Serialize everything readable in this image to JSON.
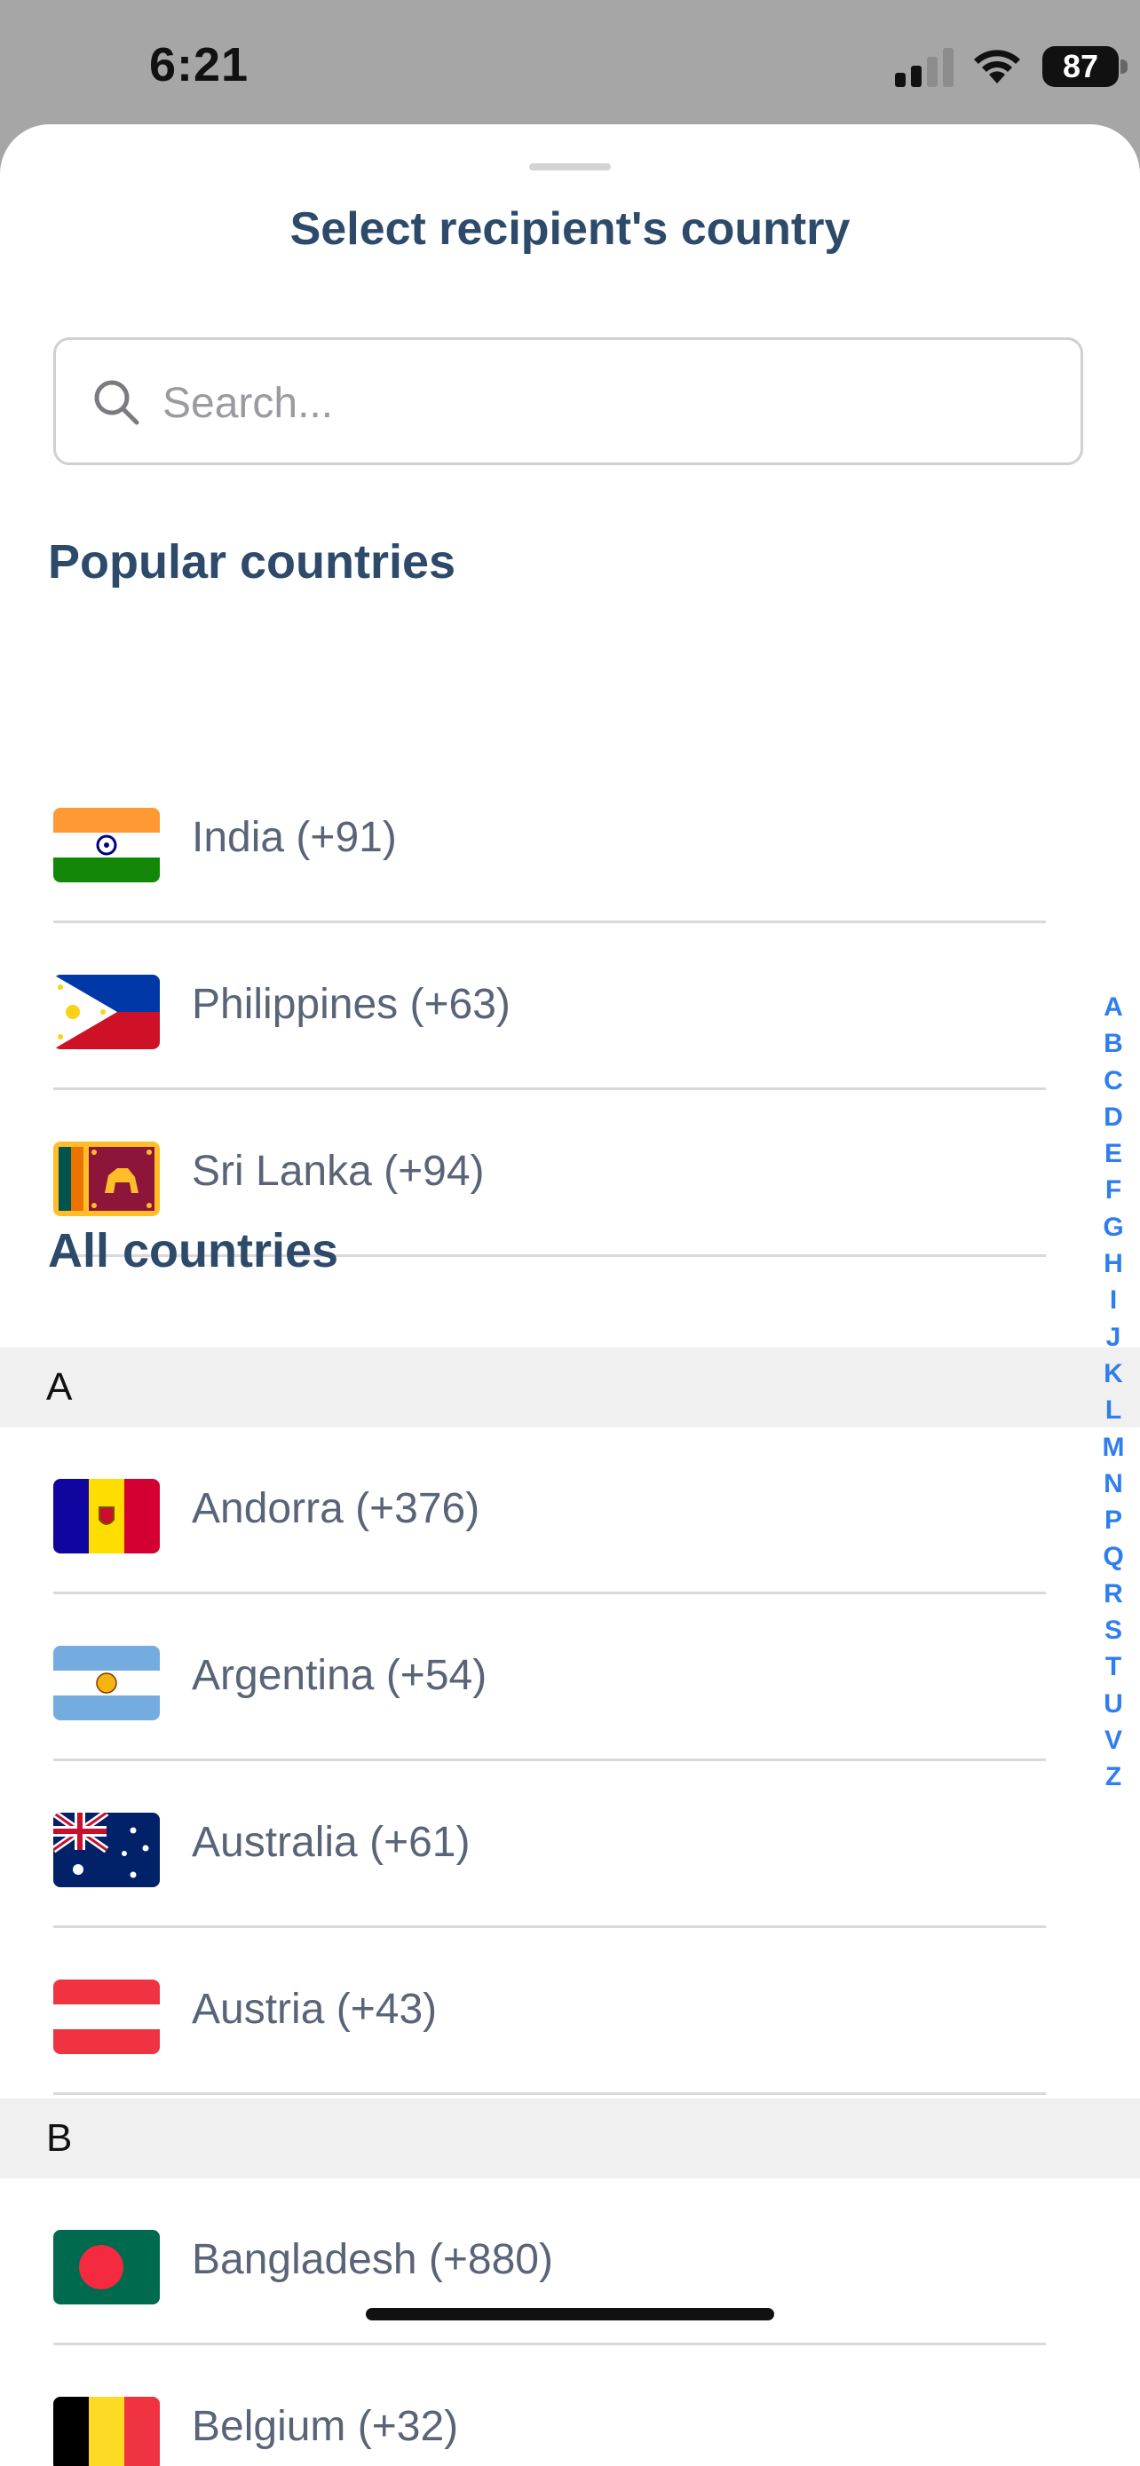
{
  "status_bar": {
    "time": "6:21",
    "battery_level": "87"
  },
  "sheet": {
    "title": "Select recipient's country",
    "search": {
      "placeholder": "Search...",
      "value": ""
    },
    "popular_heading": "Popular countries",
    "all_heading": "All countries",
    "popular": [
      {
        "label": "India (+91)",
        "flag_icon": "india-flag-icon"
      },
      {
        "label": "Philippines (+63)",
        "flag_icon": "philippines-flag-icon"
      },
      {
        "label": "Sri Lanka (+94)",
        "flag_icon": "sri-lanka-flag-icon"
      }
    ],
    "groups": [
      {
        "letter": "A",
        "countries": [
          {
            "label": "Andorra (+376)",
            "flag_icon": "andorra-flag-icon"
          },
          {
            "label": "Argentina (+54)",
            "flag_icon": "argentina-flag-icon"
          },
          {
            "label": "Australia (+61)",
            "flag_icon": "australia-flag-icon"
          },
          {
            "label": "Austria (+43)",
            "flag_icon": "austria-flag-icon"
          }
        ]
      },
      {
        "letter": "B",
        "countries": [
          {
            "label": "Bangladesh (+880)",
            "flag_icon": "bangladesh-flag-icon"
          },
          {
            "label": "Belgium (+32)",
            "flag_icon": "belgium-flag-icon"
          }
        ]
      }
    ],
    "alphabet_index": [
      "A",
      "B",
      "C",
      "D",
      "E",
      "F",
      "G",
      "H",
      "I",
      "J",
      "K",
      "L",
      "M",
      "N",
      "P",
      "Q",
      "R",
      "S",
      "T",
      "U",
      "V",
      "Z"
    ]
  },
  "colors": {
    "heading": "#2d4a6b",
    "index": "#2f7ef0",
    "overlay": "#a6a6a6"
  }
}
